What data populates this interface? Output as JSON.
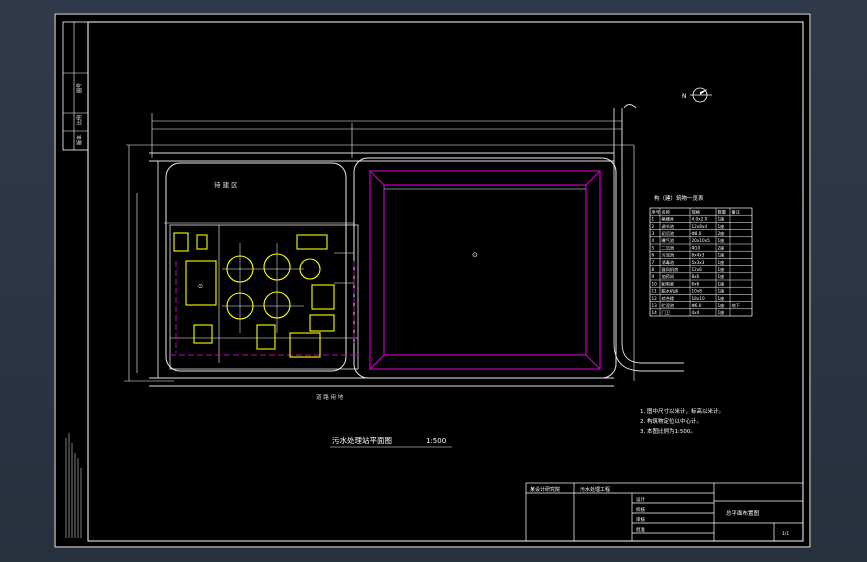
{
  "drawing": {
    "title": "污水处理站平面图",
    "scale": "1:500",
    "north_label": "N",
    "zone_label": "待 建 区",
    "road_label": "道 路 用 地",
    "pool_label": "⊙",
    "building_label": "⊙"
  },
  "table": {
    "title": "构（建）筑物一览表",
    "headers": [
      "序号",
      "名称",
      "规格",
      "数量",
      "备注"
    ],
    "rows": [
      [
        "1",
        "格栅井",
        "4.0x2.0",
        "1座",
        ""
      ],
      [
        "2",
        "调节池",
        "12x8x4",
        "1座",
        ""
      ],
      [
        "3",
        "初沉池",
        "Φ8.0",
        "2座",
        ""
      ],
      [
        "4",
        "曝气池",
        "20x10x5",
        "1座",
        ""
      ],
      [
        "5",
        "二沉池",
        "Φ10",
        "2座",
        ""
      ],
      [
        "6",
        "污泥池",
        "6x4x3",
        "1座",
        ""
      ],
      [
        "7",
        "消毒池",
        "5x3x3",
        "1座",
        ""
      ],
      [
        "8",
        "鼓风机房",
        "12x6",
        "1座",
        ""
      ],
      [
        "9",
        "加药间",
        "8x6",
        "1座",
        ""
      ],
      [
        "10",
        "配电室",
        "6x6",
        "1座",
        ""
      ],
      [
        "11",
        "脱水机房",
        "10x8",
        "1座",
        ""
      ],
      [
        "12",
        "综合楼",
        "18x10",
        "1座",
        ""
      ],
      [
        "13",
        "贮泥池",
        "Φ6.0",
        "1座",
        "地下"
      ],
      [
        "14",
        "门卫",
        "4x4",
        "1座",
        ""
      ]
    ]
  },
  "notes": [
    "1. 图中尺寸以米计，标高以米计。",
    "2. 构筑物定位以中心计。",
    "3. 本图比例为1:500。"
  ],
  "title_block": {
    "company": "某设计研究院",
    "project": "污水处理工程",
    "drawing_name": "总平面布置图",
    "rows": [
      "设计",
      "校核",
      "审核",
      "批准"
    ],
    "sheet": "1/1"
  },
  "left_strip": {
    "labels": [
      "图号",
      "比例",
      "版本"
    ]
  }
}
